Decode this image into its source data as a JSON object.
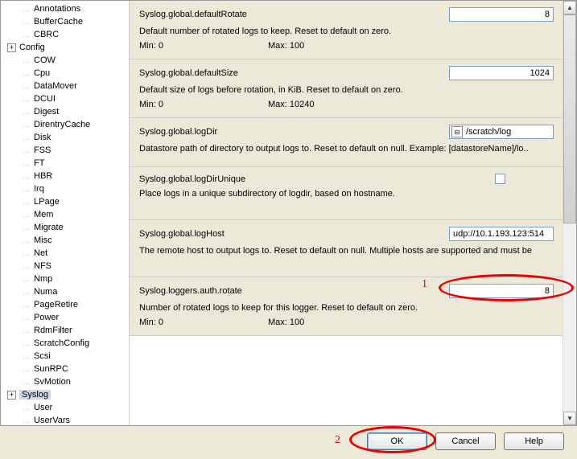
{
  "tree": {
    "items": [
      {
        "label": "Annotations",
        "level": 1,
        "exp": ""
      },
      {
        "label": "BufferCache",
        "level": 1,
        "exp": ""
      },
      {
        "label": "CBRC",
        "level": 1,
        "exp": ""
      },
      {
        "label": "Config",
        "level": 1,
        "exp": "+"
      },
      {
        "label": "COW",
        "level": 1,
        "exp": ""
      },
      {
        "label": "Cpu",
        "level": 1,
        "exp": ""
      },
      {
        "label": "DataMover",
        "level": 1,
        "exp": ""
      },
      {
        "label": "DCUI",
        "level": 1,
        "exp": ""
      },
      {
        "label": "Digest",
        "level": 1,
        "exp": ""
      },
      {
        "label": "DirentryCache",
        "level": 1,
        "exp": ""
      },
      {
        "label": "Disk",
        "level": 1,
        "exp": ""
      },
      {
        "label": "FSS",
        "level": 1,
        "exp": ""
      },
      {
        "label": "FT",
        "level": 1,
        "exp": ""
      },
      {
        "label": "HBR",
        "level": 1,
        "exp": ""
      },
      {
        "label": "Irq",
        "level": 1,
        "exp": ""
      },
      {
        "label": "LPage",
        "level": 1,
        "exp": ""
      },
      {
        "label": "Mem",
        "level": 1,
        "exp": ""
      },
      {
        "label": "Migrate",
        "level": 1,
        "exp": ""
      },
      {
        "label": "Misc",
        "level": 1,
        "exp": ""
      },
      {
        "label": "Net",
        "level": 1,
        "exp": ""
      },
      {
        "label": "NFS",
        "level": 1,
        "exp": ""
      },
      {
        "label": "Nmp",
        "level": 1,
        "exp": ""
      },
      {
        "label": "Numa",
        "level": 1,
        "exp": ""
      },
      {
        "label": "PageRetire",
        "level": 1,
        "exp": ""
      },
      {
        "label": "Power",
        "level": 1,
        "exp": ""
      },
      {
        "label": "RdmFilter",
        "level": 1,
        "exp": ""
      },
      {
        "label": "ScratchConfig",
        "level": 1,
        "exp": ""
      },
      {
        "label": "Scsi",
        "level": 1,
        "exp": ""
      },
      {
        "label": "SunRPC",
        "level": 1,
        "exp": ""
      },
      {
        "label": "SvMotion",
        "level": 1,
        "exp": ""
      },
      {
        "label": "Syslog",
        "level": 1,
        "exp": "+",
        "selected": true
      },
      {
        "label": "User",
        "level": 1,
        "exp": ""
      },
      {
        "label": "UserVars",
        "level": 1,
        "exp": ""
      }
    ]
  },
  "sections": {
    "defaultRotate": {
      "name": "Syslog.global.defaultRotate",
      "value": "8",
      "desc": "Default number of rotated logs to keep. Reset to default on zero.",
      "min": "Min:   0",
      "max": "Max:   100"
    },
    "defaultSize": {
      "name": "Syslog.global.defaultSize",
      "value": "1024",
      "desc": "Default size of logs before rotation, in KiB. Reset to default on zero.",
      "min": "Min:   0",
      "max": "Max:   10240"
    },
    "logDir": {
      "name": "Syslog.global.logDir",
      "value": "/scratch/log",
      "desc": "Datastore path of directory to output logs to. Reset to default on null. Example: [datastoreName]/lo.."
    },
    "logDirUnique": {
      "name": "Syslog.global.logDirUnique",
      "desc": "Place logs in a unique subdirectory of logdir, based on hostname."
    },
    "logHost": {
      "name": "Syslog.global.logHost",
      "value": "udp://10.1.193.123:514",
      "desc": "The remote host to output logs to. Reset to default on null. Multiple hosts are supported and must be"
    },
    "authRotate": {
      "name": "Syslog.loggers.auth.rotate",
      "value": "8",
      "desc": "Number of rotated logs to keep for this logger. Reset to default on zero.",
      "min": "Min:   0",
      "max": "Max:   100"
    }
  },
  "annotations": {
    "n1": "1",
    "n2": "2"
  },
  "buttons": {
    "ok": "OK",
    "cancel": "Cancel",
    "help": "Help"
  }
}
